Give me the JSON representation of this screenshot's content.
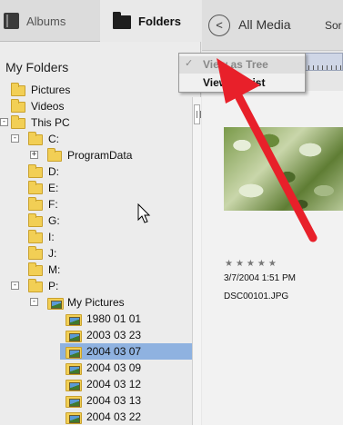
{
  "tabs": {
    "albums": "Albums",
    "folders": "Folders"
  },
  "left": {
    "title": "My Folders"
  },
  "tree": [
    {
      "label": "Pictures",
      "depth": 0,
      "exp": "",
      "icon": "folder"
    },
    {
      "label": "Videos",
      "depth": 0,
      "exp": "",
      "icon": "folder"
    },
    {
      "label": "This PC",
      "depth": 0,
      "exp": "-",
      "icon": "folder"
    },
    {
      "label": "C:",
      "depth": 1,
      "exp": "-",
      "icon": "folder"
    },
    {
      "label": "ProgramData",
      "depth": 2,
      "exp": "+",
      "icon": "folder"
    },
    {
      "label": "D:",
      "depth": 1,
      "exp": "",
      "icon": "folder"
    },
    {
      "label": "E:",
      "depth": 1,
      "exp": "",
      "icon": "folder"
    },
    {
      "label": "F:",
      "depth": 1,
      "exp": "",
      "icon": "folder"
    },
    {
      "label": "G:",
      "depth": 1,
      "exp": "",
      "icon": "folder"
    },
    {
      "label": "I:",
      "depth": 1,
      "exp": "",
      "icon": "folder"
    },
    {
      "label": "J:",
      "depth": 1,
      "exp": "",
      "icon": "folder"
    },
    {
      "label": "M:",
      "depth": 1,
      "exp": "",
      "icon": "folder"
    },
    {
      "label": "P:",
      "depth": 1,
      "exp": "-",
      "icon": "folder"
    },
    {
      "label": "My Pictures",
      "depth": 2,
      "exp": "-",
      "icon": "picture-folder"
    },
    {
      "label": "1980 01 01",
      "depth": 3,
      "exp": "",
      "icon": "picture-folder"
    },
    {
      "label": "2003 03 23",
      "depth": 3,
      "exp": "",
      "icon": "picture-folder"
    },
    {
      "label": "2004 03 07",
      "depth": 3,
      "exp": "",
      "icon": "picture-folder",
      "selected": true
    },
    {
      "label": "2004 03 09",
      "depth": 3,
      "exp": "",
      "icon": "picture-folder"
    },
    {
      "label": "2004 03 12",
      "depth": 3,
      "exp": "",
      "icon": "picture-folder"
    },
    {
      "label": "2004 03 13",
      "depth": 3,
      "exp": "",
      "icon": "picture-folder"
    },
    {
      "label": "2004 03 22",
      "depth": 3,
      "exp": "",
      "icon": "picture-folder"
    }
  ],
  "right": {
    "back_glyph": "<",
    "title": "All Media",
    "sort": "Sor"
  },
  "menu": {
    "check_glyph": "✓",
    "view_as_tree": "View as Tree",
    "view_as_list": "View as List"
  },
  "media": {
    "rating_stars": "★★★★★",
    "date": "3/7/2004 1:51 PM",
    "filename": "DSC00101.JPG"
  },
  "colors": {
    "selection": "#8fb2e0",
    "folder_yellow": "#f2cf55",
    "annotation_arrow": "#e8202a"
  }
}
